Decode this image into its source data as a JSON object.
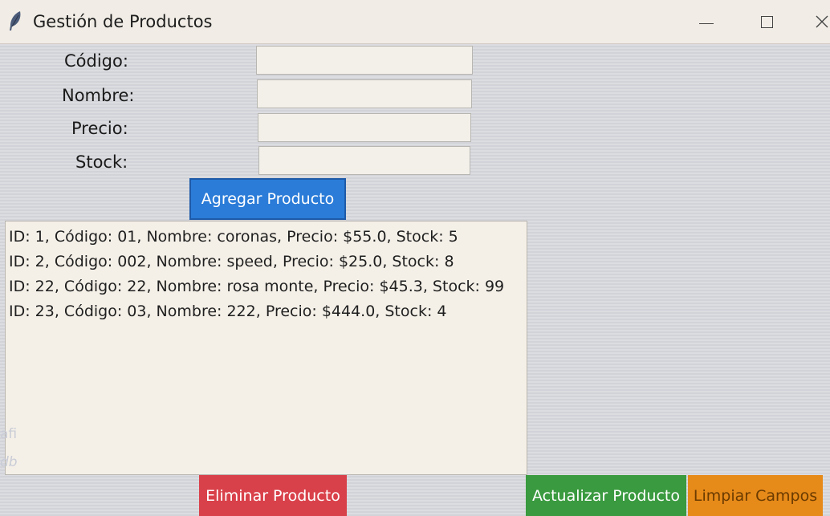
{
  "window": {
    "title": "Gestión de Productos"
  },
  "form": {
    "codigo_label": "Código:",
    "nombre_label": "Nombre:",
    "precio_label": "Precio:",
    "stock_label": "Stock:",
    "codigo_value": "",
    "nombre_value": "",
    "precio_value": "",
    "stock_value": ""
  },
  "buttons": {
    "add_label": "Agregar Producto",
    "delete_label": "Eliminar Producto",
    "update_label": "Actualizar Producto",
    "clear_label": "Limpiar Campos"
  },
  "list": {
    "items": [
      "ID: 1, Código: 01, Nombre: coronas, Precio: $55.0, Stock: 5",
      "ID: 2, Código: 002, Nombre: speed, Precio: $25.0, Stock: 8",
      "ID: 22, Código: 22, Nombre: rosa monte, Precio: $45.3, Stock: 99",
      "ID: 23, Código: 03, Nombre: 222, Precio: $444.0, Stock: 4"
    ]
  },
  "background": {
    "frag1": "afi",
    "frag2": "db"
  },
  "colors": {
    "add_button": "#2b7cd8",
    "delete_button": "#d9414a",
    "update_button": "#3a9a3f",
    "clear_button": "#e68a19"
  },
  "icons": {
    "app": "feather-icon",
    "minimize": "minimize-icon",
    "maximize": "maximize-icon",
    "close": "close-icon"
  }
}
